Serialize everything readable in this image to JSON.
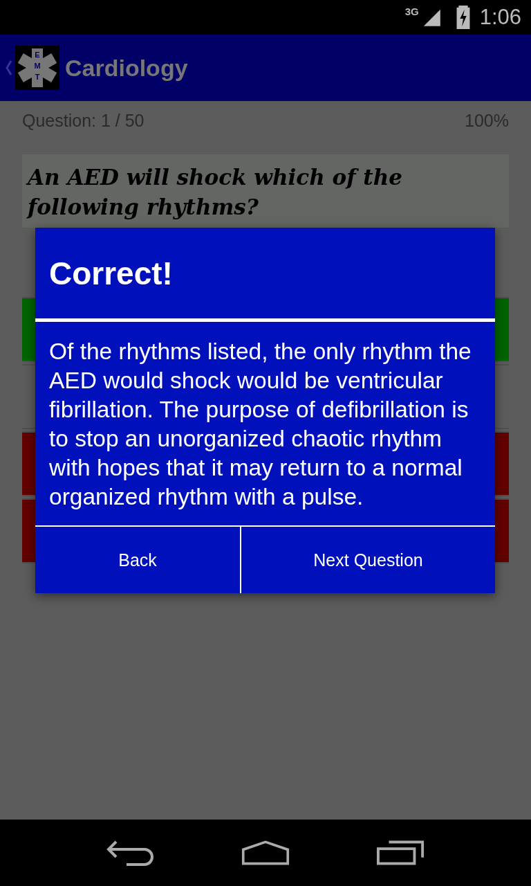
{
  "status_bar": {
    "network": "3G",
    "time": "1:06"
  },
  "app_bar": {
    "title": "Cardiology",
    "logo_letters": [
      "E",
      "M",
      "T"
    ]
  },
  "quiz": {
    "progress": "Question: 1 / 50",
    "score": "100%",
    "question": "An AED will shock which of the following rhythms?",
    "answers": [
      {
        "color": "#006400"
      },
      {
        "color": "#5c5c5c"
      },
      {
        "color": "#640000"
      },
      {
        "color": "#640000"
      }
    ]
  },
  "dialog": {
    "title": "Correct!",
    "message": "Of the rhythms listed, the only rhythm the AED would shock would be ventricular fibrillation. The purpose of defibrillation is to stop an unorganized chaotic rhythm with hopes that it may return to a normal organized rhythm with a pulse.",
    "buttons": [
      "Back",
      "Next Question"
    ]
  }
}
